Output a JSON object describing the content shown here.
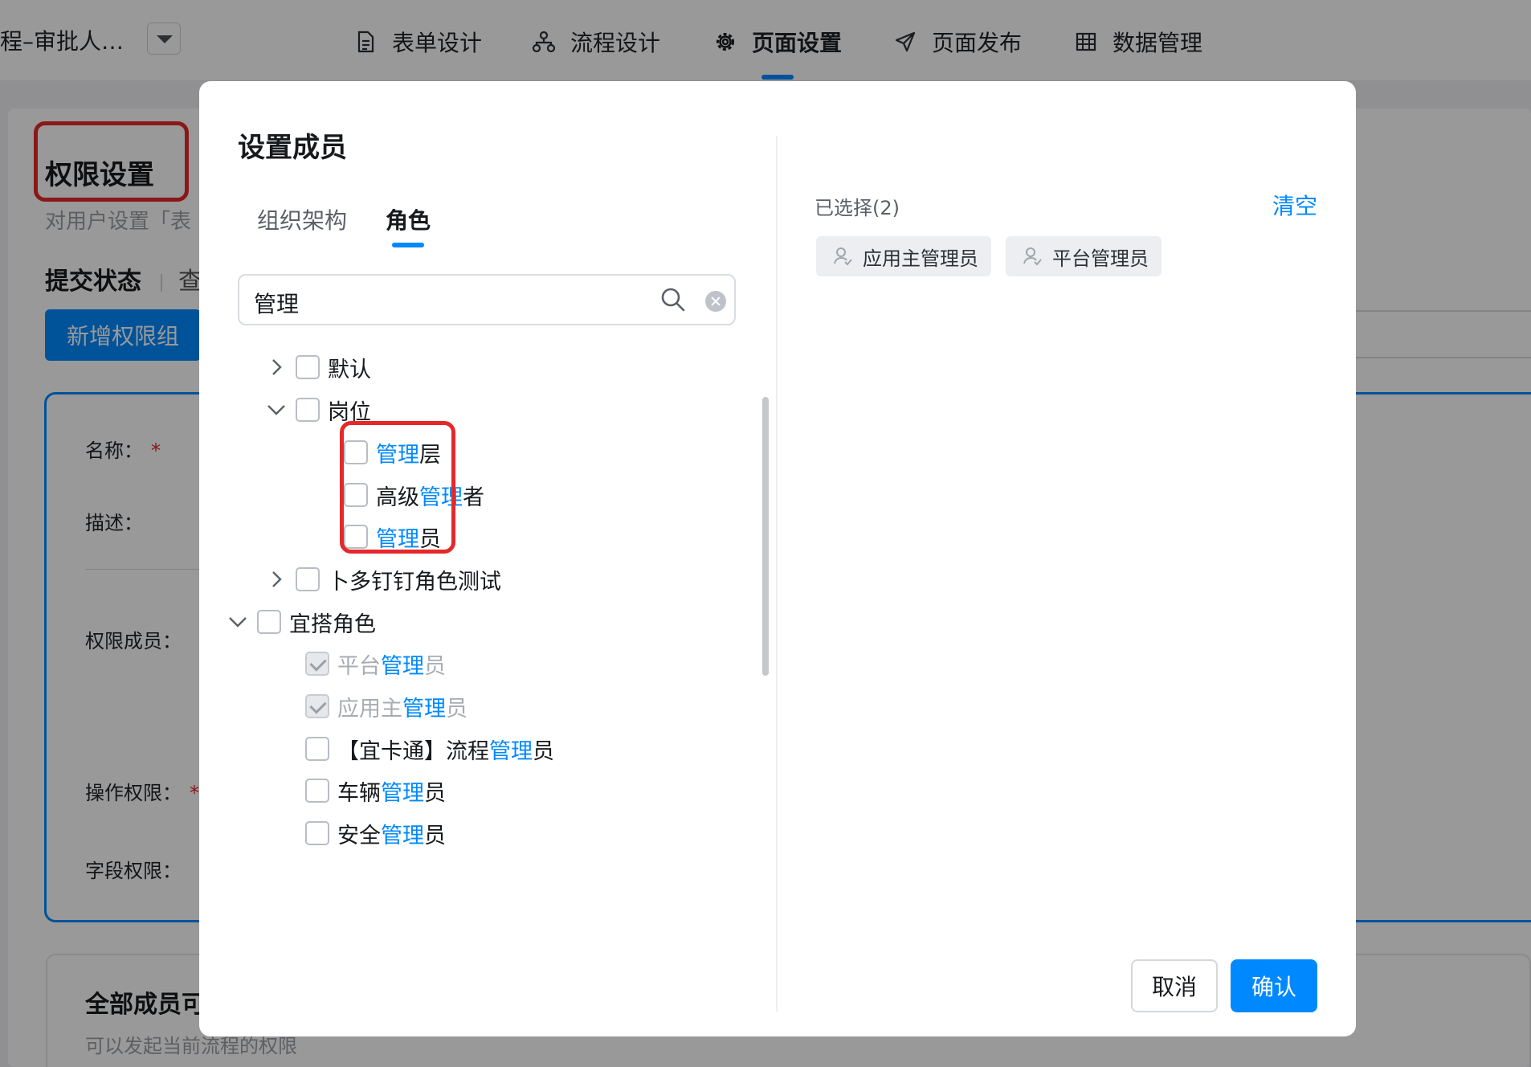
{
  "topnav": {
    "app_title": "程–审批人…",
    "tabs": [
      {
        "label": "表单设计",
        "icon": "form-icon"
      },
      {
        "label": "流程设计",
        "icon": "flow-icon"
      },
      {
        "label": "页面设置",
        "icon": "gear-icon",
        "active": true
      },
      {
        "label": "页面发布",
        "icon": "send-icon"
      },
      {
        "label": "数据管理",
        "icon": "table-icon"
      }
    ]
  },
  "page": {
    "title": "权限设置",
    "description": "对用户设置「表",
    "tab_active": "提交状态",
    "tab_next": "查",
    "add_group_label": "新增权限组",
    "fields": {
      "name": "名称：",
      "desc": "描述：",
      "members": "权限成员：",
      "operation": "操作权限：",
      "field_perm": "字段权限："
    },
    "required_mark": "*",
    "all_members_title": "全部成员可",
    "all_members_desc": "可以发起当前流程的权限"
  },
  "modal": {
    "title": "设置成员",
    "tabs": [
      {
        "label": "组织架构"
      },
      {
        "label": "角色",
        "active": true
      }
    ],
    "search": {
      "value": "管理"
    },
    "tree": [
      {
        "label": "默认",
        "collapsed": true
      },
      {
        "label": "岗位",
        "expanded": true
      },
      {
        "pre": "",
        "hl": "管理",
        "post": "层"
      },
      {
        "pre": "高级",
        "hl": "管理",
        "post": "者"
      },
      {
        "pre": "",
        "hl": "管理",
        "post": "员"
      },
      {
        "label": "卜多钉钉角色测试",
        "collapsed": true
      },
      {
        "label": "宜搭角色",
        "expanded": true
      },
      {
        "pre": "平台",
        "hl": "管理",
        "post": "员",
        "checked": true,
        "disabled": true
      },
      {
        "pre": "应用主",
        "hl": "管理",
        "post": "员",
        "checked": true,
        "disabled": true
      },
      {
        "pre": "【宜卡通】流程",
        "hl": "管理",
        "post": "员"
      },
      {
        "pre": "车辆",
        "hl": "管理",
        "post": "员"
      },
      {
        "pre": "安全",
        "hl": "管理",
        "post": "员"
      }
    ],
    "selected_label": "已选择(2)",
    "clear_label": "清空",
    "selected_chips": [
      "应用主管理员",
      "平台管理员"
    ],
    "cancel_label": "取消",
    "confirm_label": "确认"
  },
  "colors": {
    "accent": "#0089ff",
    "annotation_red": "#e5282a"
  }
}
